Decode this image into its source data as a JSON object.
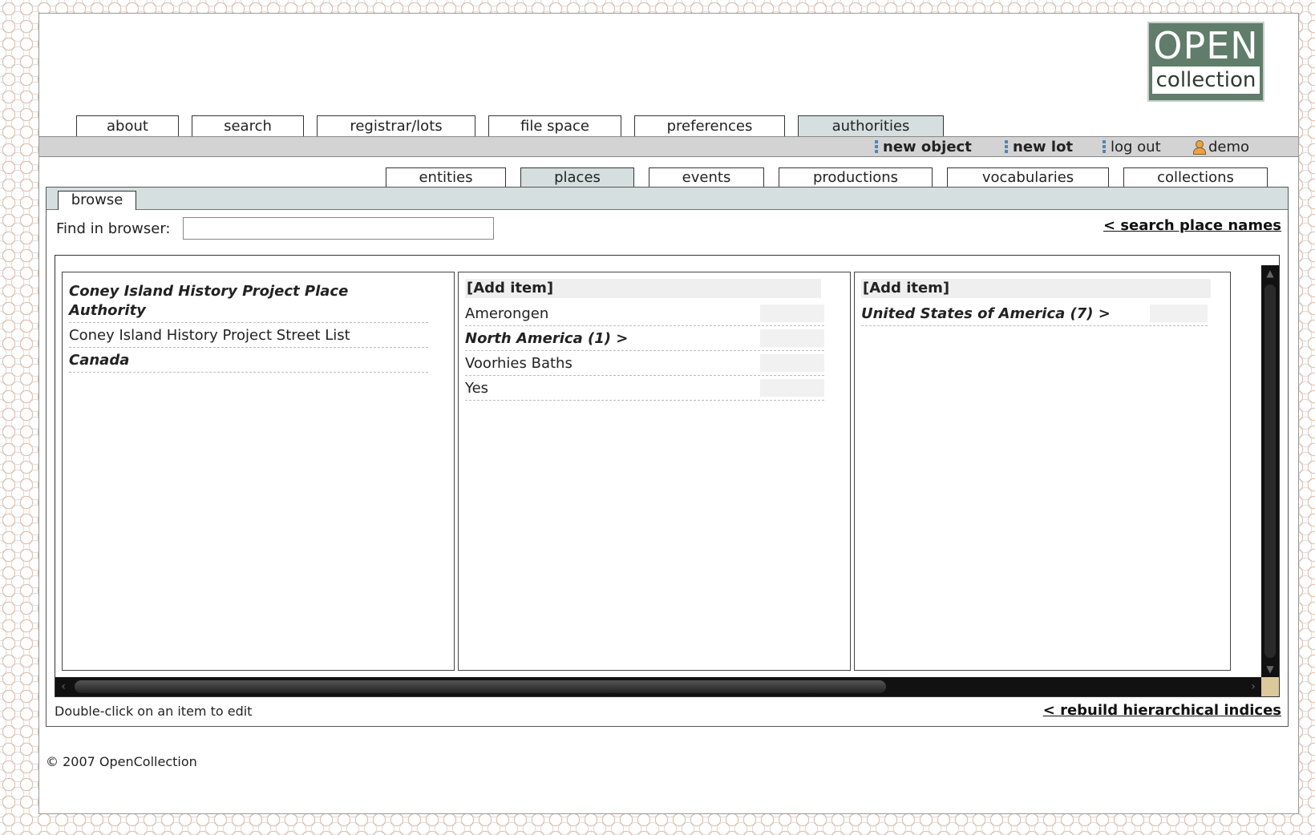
{
  "logo": {
    "top": "OPEN",
    "bottom": "collection"
  },
  "main_tabs": [
    "about",
    "search",
    "registrar/lots",
    "file space",
    "preferences",
    "authorities"
  ],
  "toolbar": {
    "new_object": "new object",
    "new_lot": "new lot",
    "log_out": "log out",
    "user": "demo"
  },
  "sub_tabs": [
    "entities",
    "places",
    "events",
    "productions",
    "vocabularies",
    "collections"
  ],
  "panel": {
    "browse_tab": "browse",
    "find_label": "Find in browser:",
    "find_value": "",
    "search_link": "< search place names",
    "hint": "Double-click on an item to edit",
    "rebuild_link": "< rebuild hierarchical indices"
  },
  "columns": {
    "col1": [
      "Coney Island History Project Place Authority",
      "Coney Island History Project Street List",
      "Canada"
    ],
    "col2": {
      "add": "[Add item]",
      "items": [
        "Amerongen",
        "North America (1) >",
        "Voorhies Baths",
        "Yes"
      ]
    },
    "col3": {
      "add": "[Add item]",
      "items": [
        "United States of America (7) >"
      ]
    }
  },
  "footer": "© 2007 OpenCollection"
}
